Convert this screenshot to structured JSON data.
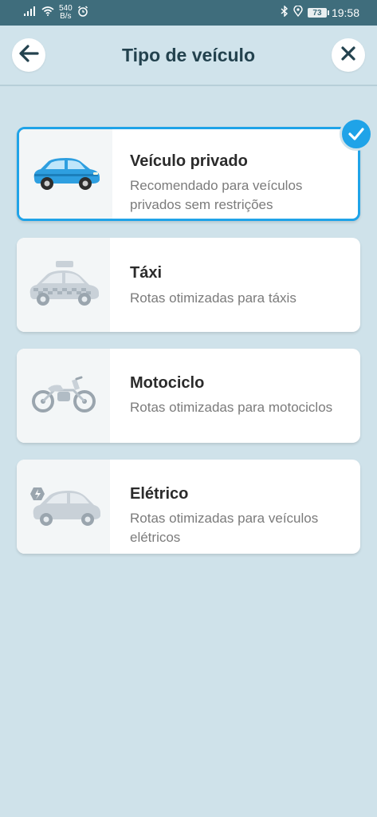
{
  "status_bar": {
    "speed_value": "540",
    "speed_unit": "B/s",
    "battery": "73",
    "time": "19:58"
  },
  "header": {
    "title": "Tipo de veículo"
  },
  "vehicles": [
    {
      "title": "Veículo privado",
      "description": "Recomendado para veículos privados sem restrições",
      "selected": true,
      "icon": "car-icon"
    },
    {
      "title": "Táxi",
      "description": "Rotas otimizadas para táxis",
      "selected": false,
      "icon": "taxi-icon"
    },
    {
      "title": "Motociclo",
      "description": "Rotas otimizadas para motociclos",
      "selected": false,
      "icon": "motorcycle-icon"
    },
    {
      "title": "Elétrico",
      "description": "Rotas otimizadas para veículos elétricos",
      "selected": false,
      "icon": "electric-car-icon"
    }
  ],
  "colors": {
    "accent": "#1fa3e8",
    "status_bar": "#3f6d7c",
    "background": "#cfe2ea",
    "title_text": "#23424e"
  }
}
